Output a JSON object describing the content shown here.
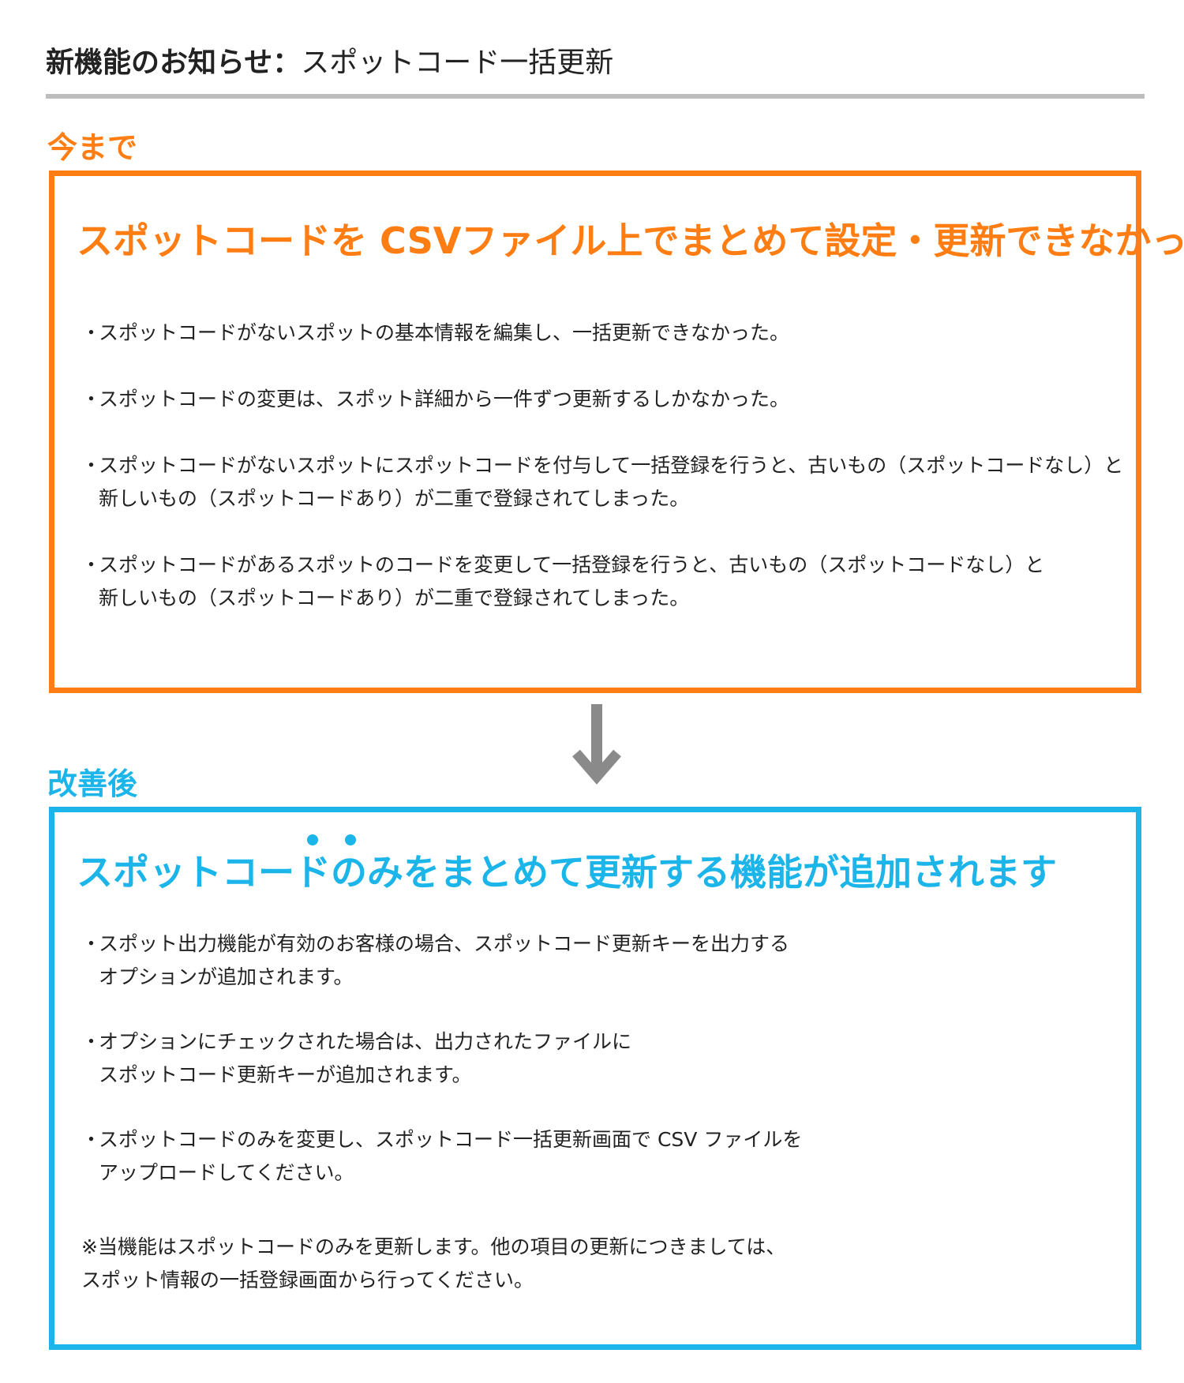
{
  "header": {
    "title_bold": "新機能のお知らせ：",
    "title_rest": "スポットコード一括更新"
  },
  "before": {
    "label": "今まで",
    "heading": "スポットコードを CSVファイル上でまとめて設定・更新できなかった",
    "items": [
      {
        "lines": [
          "スポットコードがないスポットの基本情報を編集し、一括更新できなかった。"
        ]
      },
      {
        "lines": [
          "スポットコードの変更は、スポット詳細から一件ずつ更新するしかなかった。"
        ]
      },
      {
        "lines": [
          "スポットコードがないスポットにスポットコードを付与して一括登録を行うと、古いもの（スポットコードなし）と",
          "新しいもの（スポットコードあり）が二重で登録されてしまった。"
        ]
      },
      {
        "lines": [
          "スポットコードがあるスポットのコードを変更して一括登録を行うと、古いもの（スポットコードなし）と",
          "新しいもの（スポットコードあり）が二重で登録されてしまった。"
        ]
      }
    ]
  },
  "after": {
    "label": "改善後",
    "heading": "スポットコードのみをまとめて更新する機能が追加されます",
    "items": [
      {
        "lines": [
          "スポット出力機能が有効のお客様の場合、スポットコード更新キーを出力する",
          "オプションが追加されます。"
        ]
      },
      {
        "lines": [
          "オプションにチェックされた場合は、出力されたファイルに",
          "スポットコード更新キーが追加されます。"
        ]
      },
      {
        "lines": [
          "スポットコードのみを変更し、スポットコード一括更新画面で CSV ファイルを",
          "アップロードしてください。"
        ]
      }
    ],
    "note_lines": [
      "※当機能はスポットコードのみを更新します。他の項目の更新につきましては、",
      "スポット情報の一括登録画面から行ってください。"
    ]
  },
  "bullet_char": "・",
  "colors": {
    "before_accent": "#ff7d12",
    "after_accent": "#1cb5ea",
    "rule": "#bdbdbd",
    "arrow": "#8a8a8a",
    "text": "#222222"
  },
  "icons": {
    "transition": "arrow-down-icon",
    "emphasis": "emphasis-dots-icon"
  }
}
